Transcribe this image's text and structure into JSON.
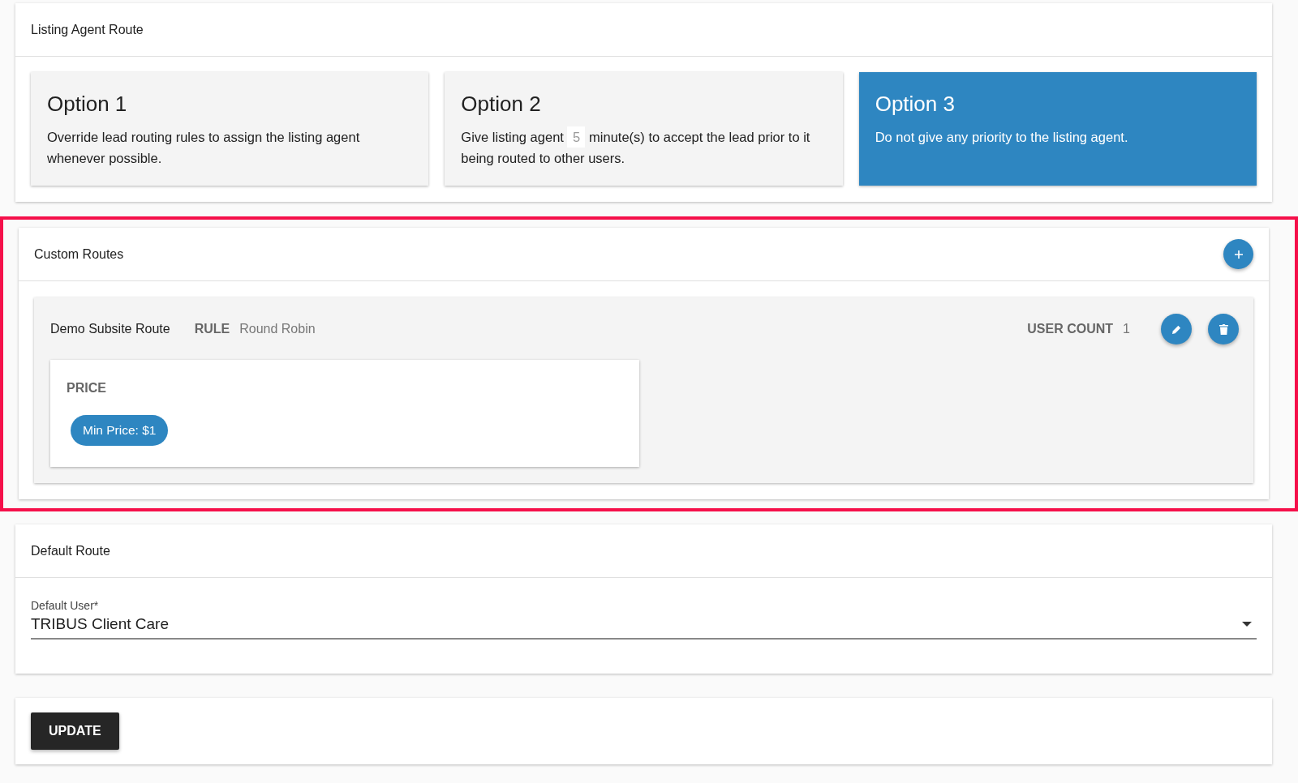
{
  "listing_agent_route": {
    "title": "Listing Agent Route",
    "options": [
      {
        "title": "Option 1",
        "kind": "text",
        "selected": false,
        "text": "Override lead routing rules to assign the listing agent whenever possible."
      },
      {
        "title": "Option 2",
        "kind": "input",
        "selected": false,
        "text_before": "Give listing agent",
        "minutes": "5",
        "text_after": "minute(s) to accept the lead prior to it being routed to other users."
      },
      {
        "title": "Option 3",
        "kind": "text",
        "selected": true,
        "text": "Do not give any priority to the listing agent."
      }
    ]
  },
  "custom_routes": {
    "title": "Custom Routes",
    "highlighted": true,
    "routes": [
      {
        "name": "Demo Subsite Route",
        "rule_label": "RULE",
        "rule": "Round Robin",
        "user_count_label": "USER COUNT",
        "user_count": "1",
        "criteria": [
          {
            "title": "PRICE",
            "chips": [
              "Min Price: $1"
            ]
          }
        ]
      }
    ]
  },
  "default_route": {
    "title": "Default Route",
    "field_label": "Default User*",
    "value": "TRIBUS Client Care"
  },
  "update_button": "UPDATE"
}
